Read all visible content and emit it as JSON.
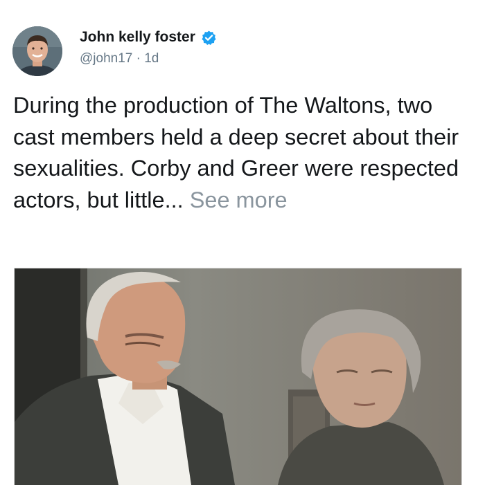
{
  "tweet": {
    "author_name": "John kelly foster",
    "handle": "@john17",
    "separator": "·",
    "age": "1d",
    "text_body": "During the production of The Waltons, two cast members held a deep secret about their sexualities. Corby and Greer were respected actors, but little...",
    "see_more": "See more",
    "verified_icon": "verified-check-icon",
    "accent_color": "#1da1f2"
  }
}
